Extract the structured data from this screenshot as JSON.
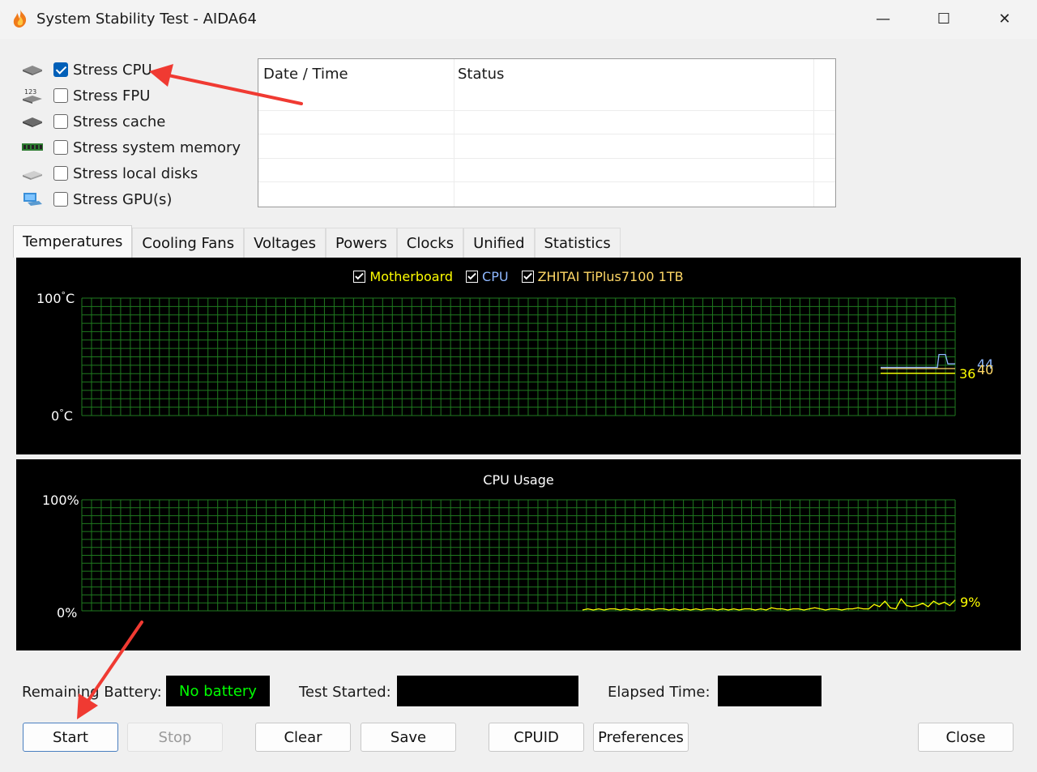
{
  "window": {
    "title": "System Stability Test - AIDA64",
    "controls": {
      "minimize": "—",
      "maximize": "☐",
      "close": "✕"
    }
  },
  "stress_options": [
    {
      "label": "Stress CPU",
      "checked": true,
      "icon": "cpu-icon"
    },
    {
      "label": "Stress FPU",
      "checked": false,
      "icon": "fpu-icon"
    },
    {
      "label": "Stress cache",
      "checked": false,
      "icon": "cache-icon"
    },
    {
      "label": "Stress system memory",
      "checked": false,
      "icon": "memory-icon"
    },
    {
      "label": "Stress local disks",
      "checked": false,
      "icon": "disk-icon"
    },
    {
      "label": "Stress GPU(s)",
      "checked": false,
      "icon": "gpu-icon"
    }
  ],
  "log": {
    "columns": [
      "Date / Time",
      "Status"
    ],
    "rows": []
  },
  "tabs": [
    {
      "label": "Temperatures",
      "active": true
    },
    {
      "label": "Cooling Fans",
      "active": false
    },
    {
      "label": "Voltages",
      "active": false
    },
    {
      "label": "Powers",
      "active": false
    },
    {
      "label": "Clocks",
      "active": false
    },
    {
      "label": "Unified",
      "active": false
    },
    {
      "label": "Statistics",
      "active": false
    }
  ],
  "temperature_graph": {
    "legend": [
      {
        "label": "Motherboard",
        "checked": true,
        "color": "#ffff00"
      },
      {
        "label": "CPU",
        "checked": true,
        "color": "#8fb8ff"
      },
      {
        "label": "ZHITAI TiPlus7100 1TB",
        "checked": true,
        "color": "#ffd866"
      }
    ],
    "y_max_label": "100",
    "y_min_label": "0",
    "unit": "C",
    "degree": "°",
    "current_values": [
      "44",
      "40",
      "36"
    ],
    "value_colors": [
      "#8fb8ff",
      "#ffd866",
      "#ffff00"
    ]
  },
  "usage_graph": {
    "title": "CPU Usage",
    "y_max_label": "100%",
    "y_min_label": "0%",
    "current_value": "9%",
    "series": [
      0,
      1,
      0,
      1,
      0,
      1,
      1,
      0,
      1,
      0,
      1,
      0,
      1,
      0,
      1,
      1,
      0,
      1,
      0,
      1,
      0,
      1,
      0,
      1,
      1,
      0,
      1,
      0,
      1,
      0,
      1,
      1,
      0,
      1,
      0,
      2,
      1,
      1,
      0,
      1,
      1,
      0,
      1,
      2,
      1,
      0,
      1,
      1,
      0,
      1,
      1,
      2,
      1,
      1,
      5,
      3,
      8,
      2,
      1,
      10,
      4,
      3,
      4,
      6,
      3,
      8,
      5,
      7,
      4,
      9
    ]
  },
  "status": {
    "battery_label": "Remaining Battery:",
    "battery_value": "No battery",
    "started_label": "Test Started:",
    "started_value": "",
    "elapsed_label": "Elapsed Time:",
    "elapsed_value": ""
  },
  "buttons": {
    "start": "Start",
    "stop": "Stop",
    "clear": "Clear",
    "save": "Save",
    "cpuid": "CPUID",
    "preferences": "Preferences",
    "close": "Close"
  },
  "colors": {
    "grid": "#1f7a1f",
    "battery_text": "#00ff00",
    "annotation_arrow": "#f03a32",
    "accent": "#005fb8"
  }
}
